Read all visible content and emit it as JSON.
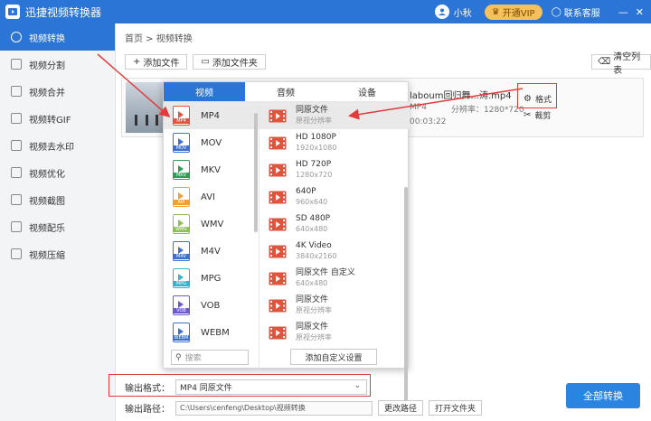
{
  "window": {
    "app_title": "迅捷视频转换器",
    "user_name": "小秋",
    "vip_label": "开通VIP",
    "service_label": "联系客服",
    "minimize": "—",
    "close": "✕"
  },
  "sidebar": {
    "items": [
      {
        "label": "视频转换",
        "icon": "convert-icon"
      },
      {
        "label": "视频分割",
        "icon": "split-icon"
      },
      {
        "label": "视频合并",
        "icon": "merge-icon"
      },
      {
        "label": "视频转GIF",
        "icon": "gif-icon"
      },
      {
        "label": "视频去水印",
        "icon": "watermark-icon"
      },
      {
        "label": "视频优化",
        "icon": "optimize-icon"
      },
      {
        "label": "视频截图",
        "icon": "screenshot-icon"
      },
      {
        "label": "视频配乐",
        "icon": "music-icon"
      },
      {
        "label": "视频压缩",
        "icon": "compress-icon"
      }
    ]
  },
  "breadcrumb": "首页 > 视频转换",
  "toolbar": {
    "add_file": "添加文件",
    "add_folder": "添加文件夹",
    "clear_list": "清空列表"
  },
  "file": {
    "name": "laboum回归舞...涛.mp4",
    "format": "MP4",
    "resolution": "分辨率：1280*720",
    "duration": "00:03:22",
    "format_btn": "格式",
    "clip_btn": "裁剪"
  },
  "popup": {
    "tabs": [
      "视频",
      "音频",
      "设备"
    ],
    "formats": [
      {
        "name": "MP4",
        "color": "#e0533c"
      },
      {
        "name": "MOV",
        "color": "#3d6fd1"
      },
      {
        "name": "MKV",
        "color": "#2e9e55"
      },
      {
        "name": "AVI",
        "color": "#f0a030"
      },
      {
        "name": "WMV",
        "color": "#8cc152"
      },
      {
        "name": "M4V",
        "color": "#3d6fd1"
      },
      {
        "name": "MPG",
        "color": "#38b2c9"
      },
      {
        "name": "VOB",
        "color": "#6a5acd"
      },
      {
        "name": "WEBM",
        "color": "#3d6fd1"
      }
    ],
    "search_placeholder": "搜索",
    "options": [
      {
        "title": "同原文件",
        "sub": "原视分辨率"
      },
      {
        "title": "HD 1080P",
        "sub": "1920x1080"
      },
      {
        "title": "HD 720P",
        "sub": "1280x720"
      },
      {
        "title": "640P",
        "sub": "960x640"
      },
      {
        "title": "SD 480P",
        "sub": "640x480"
      },
      {
        "title": "4K Video",
        "sub": "3840x2160"
      },
      {
        "title": "同原文件 自定义",
        "sub": "640x480"
      },
      {
        "title": "同原文件",
        "sub": "原视分辨率"
      },
      {
        "title": "同原文件",
        "sub": "原视分辨率"
      }
    ],
    "custom_btn": "添加自定义设置"
  },
  "bottom": {
    "output_format_label": "输出格式：",
    "output_format_value": "MP4  同原文件",
    "output_path_label": "输出路径：",
    "output_path_value": "C:\\Users\\cenfeng\\Desktop\\视频转换",
    "change_path": "更改路径",
    "open_folder": "打开文件夹",
    "convert_all": "全部转换"
  },
  "colors": {
    "accent": "#2a75d6",
    "annotation": "#e23b3b",
    "vip": "#f6c15a"
  }
}
